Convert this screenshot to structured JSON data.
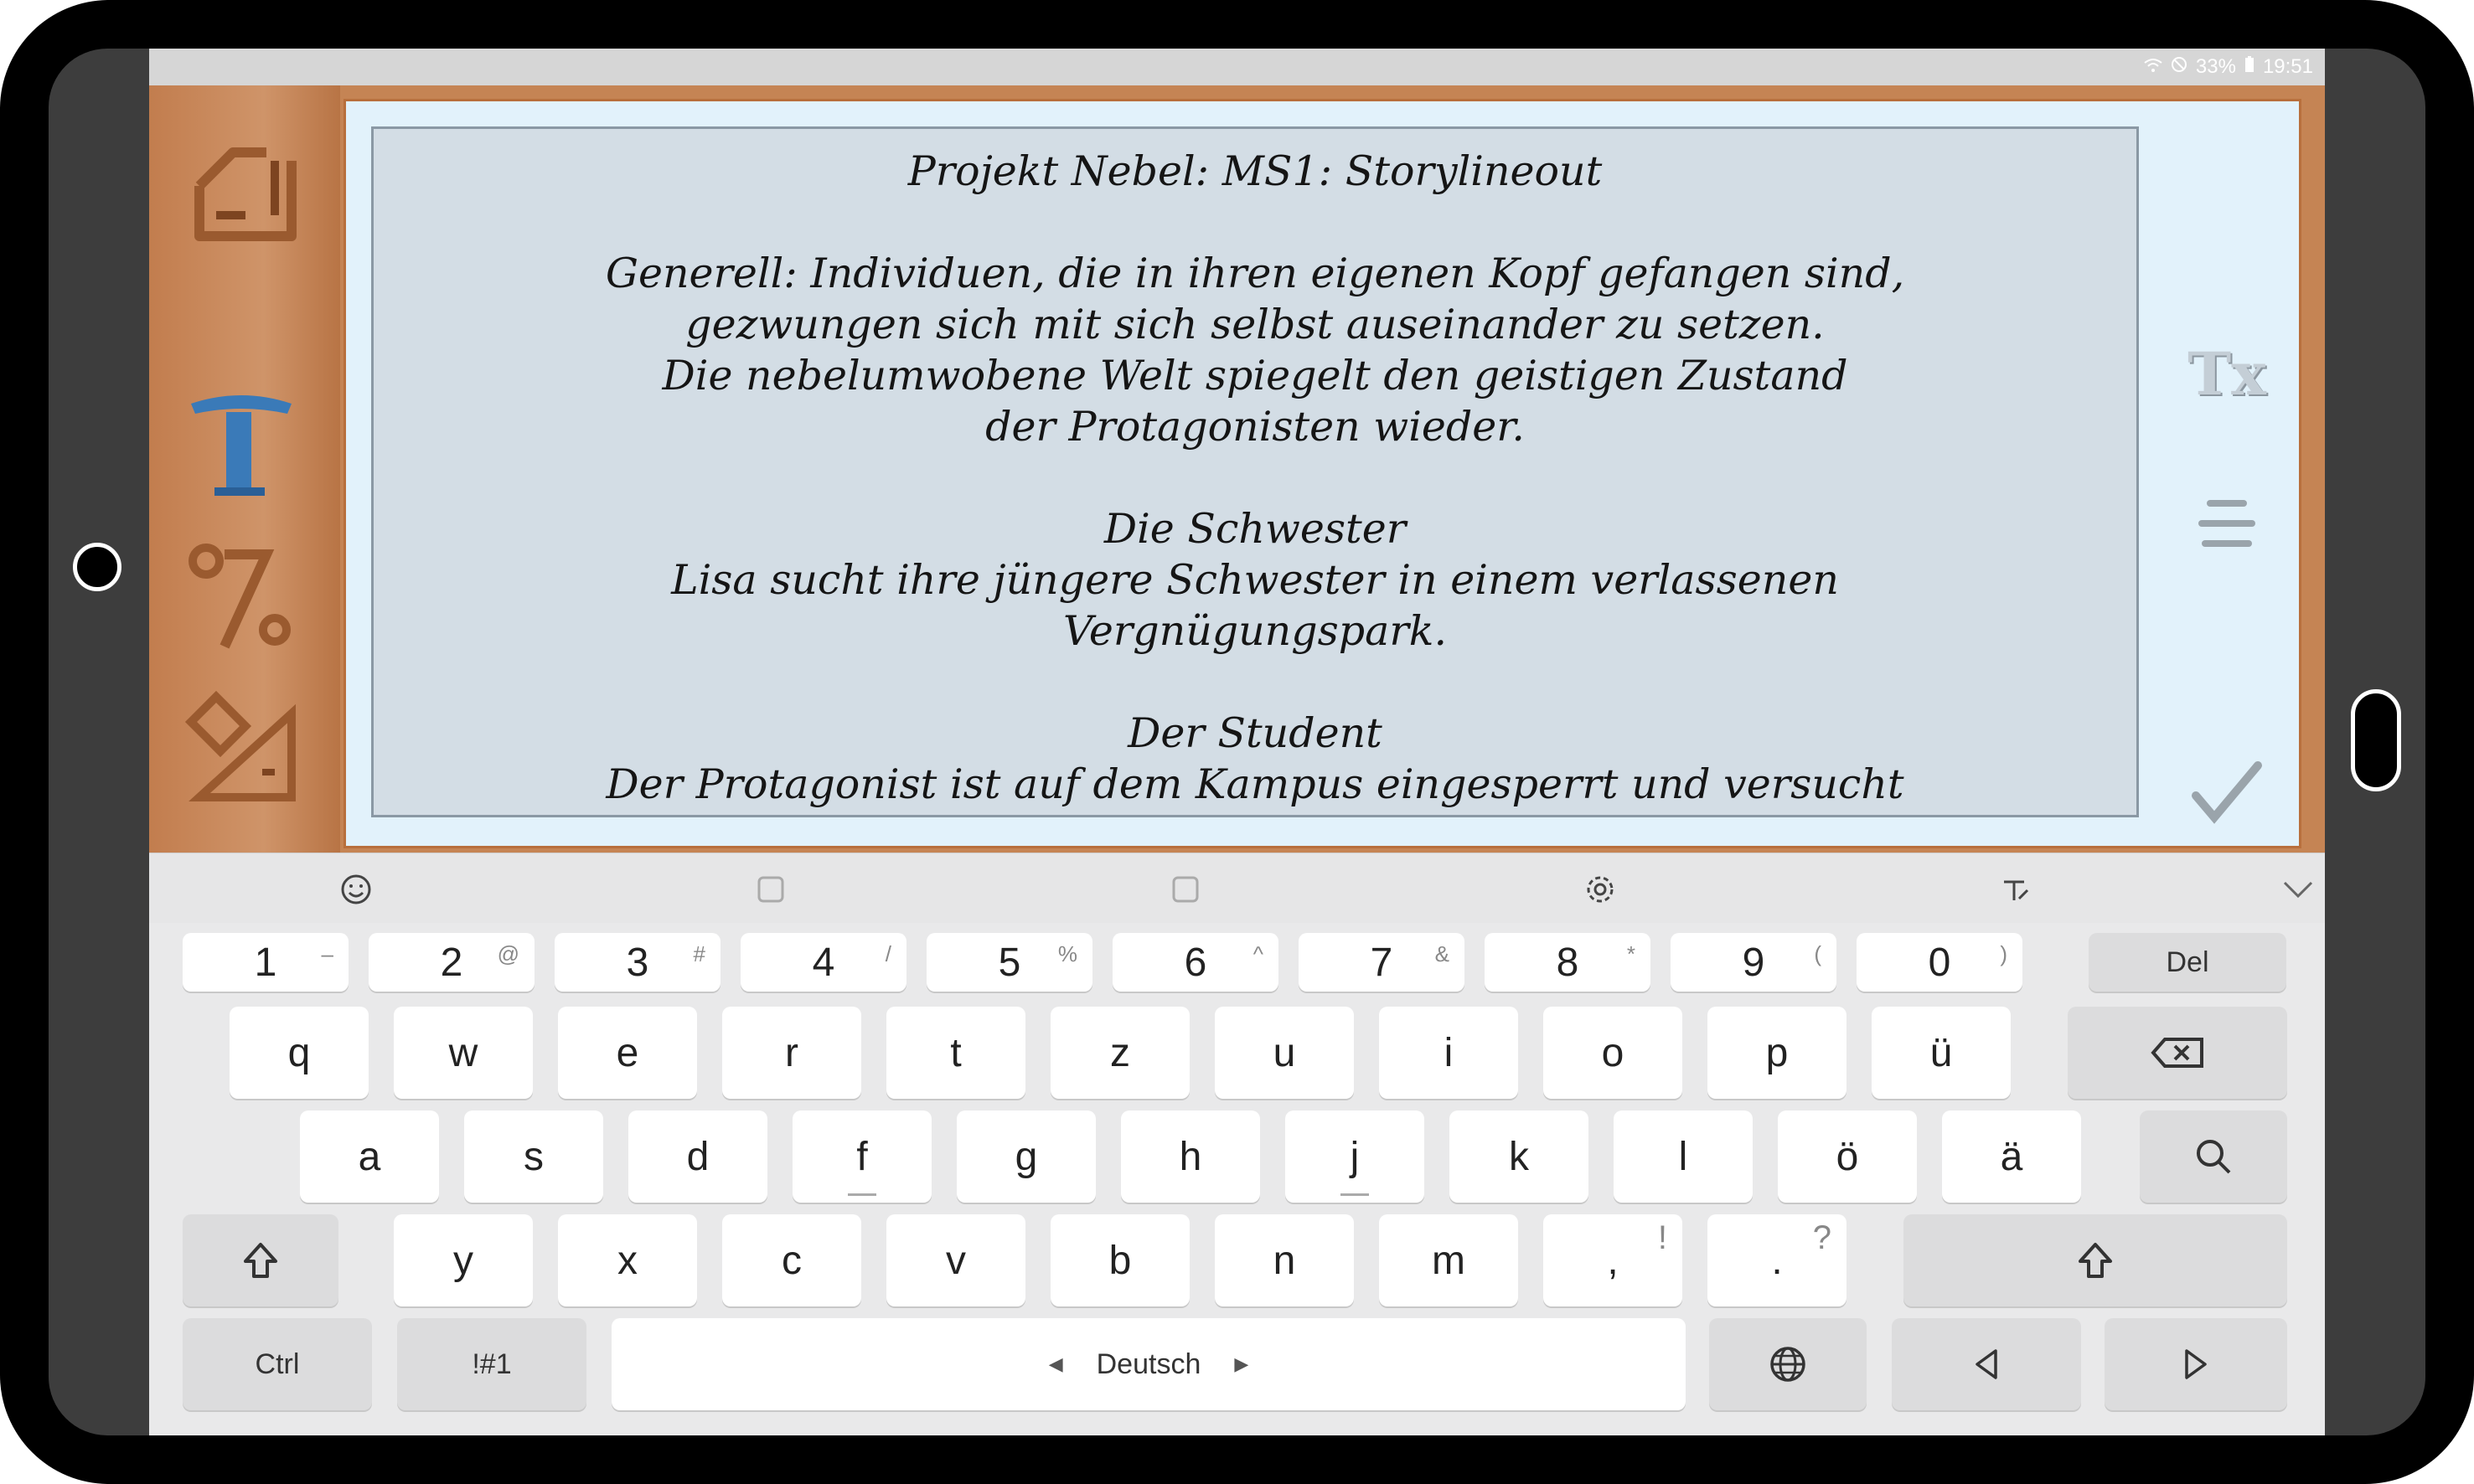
{
  "status": {
    "battery": "33%",
    "time": "19:51"
  },
  "editor": {
    "lines": [
      "Projekt Nebel: MS1: Storylineout",
      "",
      "Generell: Individuen, die in ihren eigenen Kopf gefangen sind,",
      "gezwungen sich mit sich selbst auseinander zu setzen.",
      "Die nebelumwobene Welt spiegelt den geistigen Zustand",
      "der Protagonisten wieder.",
      "",
      "Die Schwester",
      "Lisa sucht ihre jüngere Schwester in einem verlassenen",
      "Vergnügungspark.",
      "",
      "Der Student",
      "Der Protagonist ist auf dem Kampus eingesperrt und versucht"
    ]
  },
  "tools": {
    "left": [
      "export-icon",
      "text-icon",
      "percent-icon",
      "edit-shape-icon"
    ],
    "right": [
      "clear-format-icon",
      "align-center-icon",
      "confirm-check-icon"
    ],
    "right_labels": {
      "clear_format": "Tx"
    }
  },
  "keyboard": {
    "toolbar": [
      "emoji-icon",
      "sticker-icon",
      "gif-icon",
      "settings-icon",
      "handwriting-icon",
      "collapse-icon"
    ],
    "row_numbers": [
      {
        "k": "1",
        "s": "–"
      },
      {
        "k": "2",
        "s": "@"
      },
      {
        "k": "3",
        "s": "#"
      },
      {
        "k": "4",
        "s": "/"
      },
      {
        "k": "5",
        "s": "%"
      },
      {
        "k": "6",
        "s": "^"
      },
      {
        "k": "7",
        "s": "&"
      },
      {
        "k": "8",
        "s": "*"
      },
      {
        "k": "9",
        "s": "("
      },
      {
        "k": "0",
        "s": ")"
      }
    ],
    "del_label": "Del",
    "row_q": [
      "q",
      "w",
      "e",
      "r",
      "t",
      "z",
      "u",
      "i",
      "o",
      "p",
      "ü"
    ],
    "row_a": [
      "a",
      "s",
      "d",
      "f",
      "g",
      "h",
      "j",
      "k",
      "l",
      "ö",
      "ä"
    ],
    "row_y": [
      "y",
      "x",
      "c",
      "v",
      "b",
      "n",
      "m"
    ],
    "comma": {
      "k": ",",
      "s": "!"
    },
    "period": {
      "k": ".",
      "s": "?"
    },
    "ctrl_label": "Ctrl",
    "sym_label": "!#1",
    "space_label": "Deutsch"
  }
}
